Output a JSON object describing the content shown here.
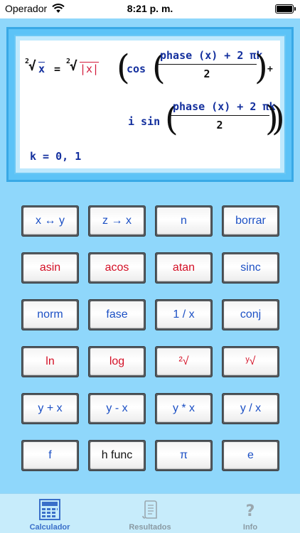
{
  "status_bar": {
    "carrier": "Operador",
    "time": "8:21 p. m.",
    "battery_level": 1.0
  },
  "display": {
    "root_index": "2",
    "x": "x",
    "abs_x": "|x|",
    "cos": "cos",
    "sin": "i sin",
    "phase_expr": "phase (x) + 2 πk",
    "denominator": "2",
    "plus": "+",
    "equals": "=",
    "k_line": "k = 0, 1"
  },
  "keypad": {
    "rows": [
      [
        {
          "label": "x ↔ y",
          "color": "blue"
        },
        {
          "label": "z → x",
          "color": "blue"
        },
        {
          "label": "n",
          "color": "blue"
        },
        {
          "label": "borrar",
          "color": "blue"
        }
      ],
      [
        {
          "label": "asin",
          "color": "red"
        },
        {
          "label": "acos",
          "color": "red"
        },
        {
          "label": "atan",
          "color": "red"
        },
        {
          "label": "sinc",
          "color": "blue"
        }
      ],
      [
        {
          "label": "norm",
          "color": "blue"
        },
        {
          "label": "fase",
          "color": "blue"
        },
        {
          "label": "1 / x",
          "color": "blue"
        },
        {
          "label": "conj",
          "color": "blue"
        }
      ],
      [
        {
          "label": "ln",
          "color": "red"
        },
        {
          "label": "log",
          "color": "red"
        },
        {
          "label": "²√",
          "color": "red"
        },
        {
          "label": "ʸ√",
          "color": "red"
        }
      ],
      [
        {
          "label": "y + x",
          "color": "blue"
        },
        {
          "label": "y - x",
          "color": "blue"
        },
        {
          "label": "y * x",
          "color": "blue"
        },
        {
          "label": "y / x",
          "color": "blue"
        }
      ],
      [
        {
          "label": "f",
          "color": "blue"
        },
        {
          "label": "h func",
          "color": "black"
        },
        {
          "label": "π",
          "color": "blue"
        },
        {
          "label": "e",
          "color": "blue"
        }
      ]
    ]
  },
  "tabs": [
    {
      "label": "Calculador",
      "icon": "calculator-icon",
      "active": true
    },
    {
      "label": "Resultados",
      "icon": "scroll-icon",
      "active": false
    },
    {
      "label": "Info",
      "icon": "question-icon",
      "active": false
    }
  ],
  "colors": {
    "background": "#8fd7fb",
    "key_blue": "#1c50c4",
    "key_red": "#d30f25",
    "tab_active": "#3a6fc9"
  }
}
